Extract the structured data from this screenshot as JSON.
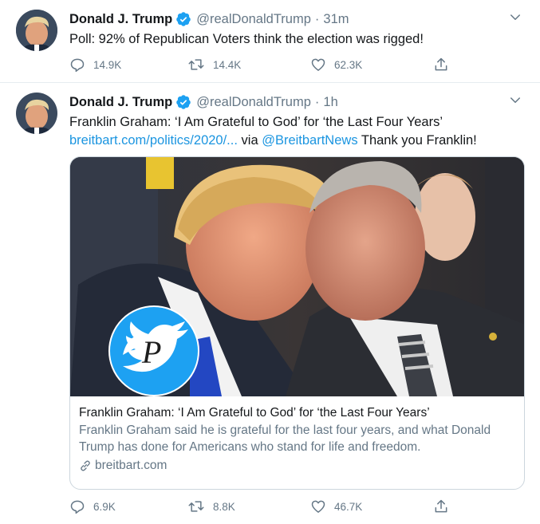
{
  "tweets": [
    {
      "display_name": "Donald J. Trump",
      "handle": "@realDonaldTrump",
      "separator": "·",
      "time": "31m",
      "text": "Poll: 92% of Republican Voters think the election was rigged!",
      "replies": "14.9K",
      "retweets": "14.4K",
      "likes": "62.3K"
    },
    {
      "display_name": "Donald J. Trump",
      "handle": "@realDonaldTrump",
      "separator": "·",
      "time": "1h",
      "text_line1": "Franklin Graham: ‘I Am Grateful to God’ for ‘the Last Four Years’",
      "link_url": "breitbart.com/politics/2020/...",
      "via_text": " via ",
      "mention": "@BreitbartNews",
      "thanks_text": " Thank you Franklin!",
      "card": {
        "title": "Franklin Graham: ‘I Am Grateful to God’ for ‘the Last Four Years’",
        "description": "Franklin Graham said he is grateful for the last four years, and what Donald Trump has done for Americans who stand for life and freedom.",
        "domain": "breitbart.com"
      },
      "replies": "6.9K",
      "retweets": "8.8K",
      "likes": "46.7K"
    }
  ],
  "colors": {
    "accent": "#1da1f2",
    "link": "#1b95e0",
    "secondary_text": "#657786",
    "border": "#e6ecf0"
  },
  "icons": [
    "verified-badge-icon",
    "chevron-down-icon",
    "reply-icon",
    "retweet-icon",
    "like-icon",
    "share-icon",
    "link-icon",
    "twitter-bird-logo"
  ]
}
